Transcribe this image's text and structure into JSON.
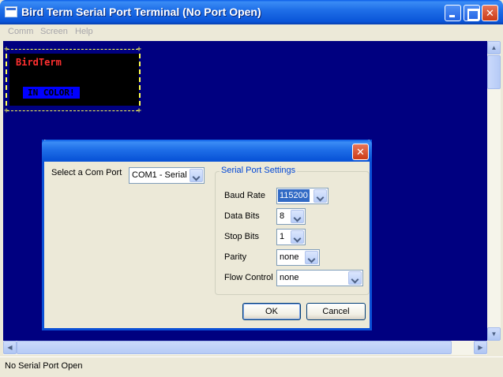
{
  "window": {
    "title": "Bird Term Serial Port Terminal (No Port Open)",
    "min_glyph": "",
    "max_glyph": "",
    "close_glyph": "✕"
  },
  "menu": {
    "items": [
      "Comm",
      "Screen",
      "Help"
    ]
  },
  "terminal": {
    "banner_title": "BirdTerm",
    "banner_subtitle": "IN COLOR!",
    "colors": {
      "background": "#000080",
      "border": "#ffff54",
      "title": "#ff3030",
      "highlight": "#0000ff"
    }
  },
  "scrollbars": {
    "up": "▲",
    "down": "▼",
    "left": "◀",
    "right": "▶"
  },
  "status": {
    "text": "No Serial Port Open"
  },
  "dialog": {
    "close_glyph": "✕",
    "com_port_label": "Select a Com Port",
    "com_port_value": "COM1 - Serial",
    "group_title": "Serial Port Settings",
    "baud_rate": {
      "label": "Baud Rate",
      "value": "115200"
    },
    "data_bits": {
      "label": "Data Bits",
      "value": "8"
    },
    "stop_bits": {
      "label": "Stop Bits",
      "value": "1"
    },
    "parity": {
      "label": "Parity",
      "value": "none"
    },
    "flow_control": {
      "label": "Flow Control",
      "value": "none"
    },
    "ok_label": "OK",
    "cancel_label": "Cancel"
  }
}
